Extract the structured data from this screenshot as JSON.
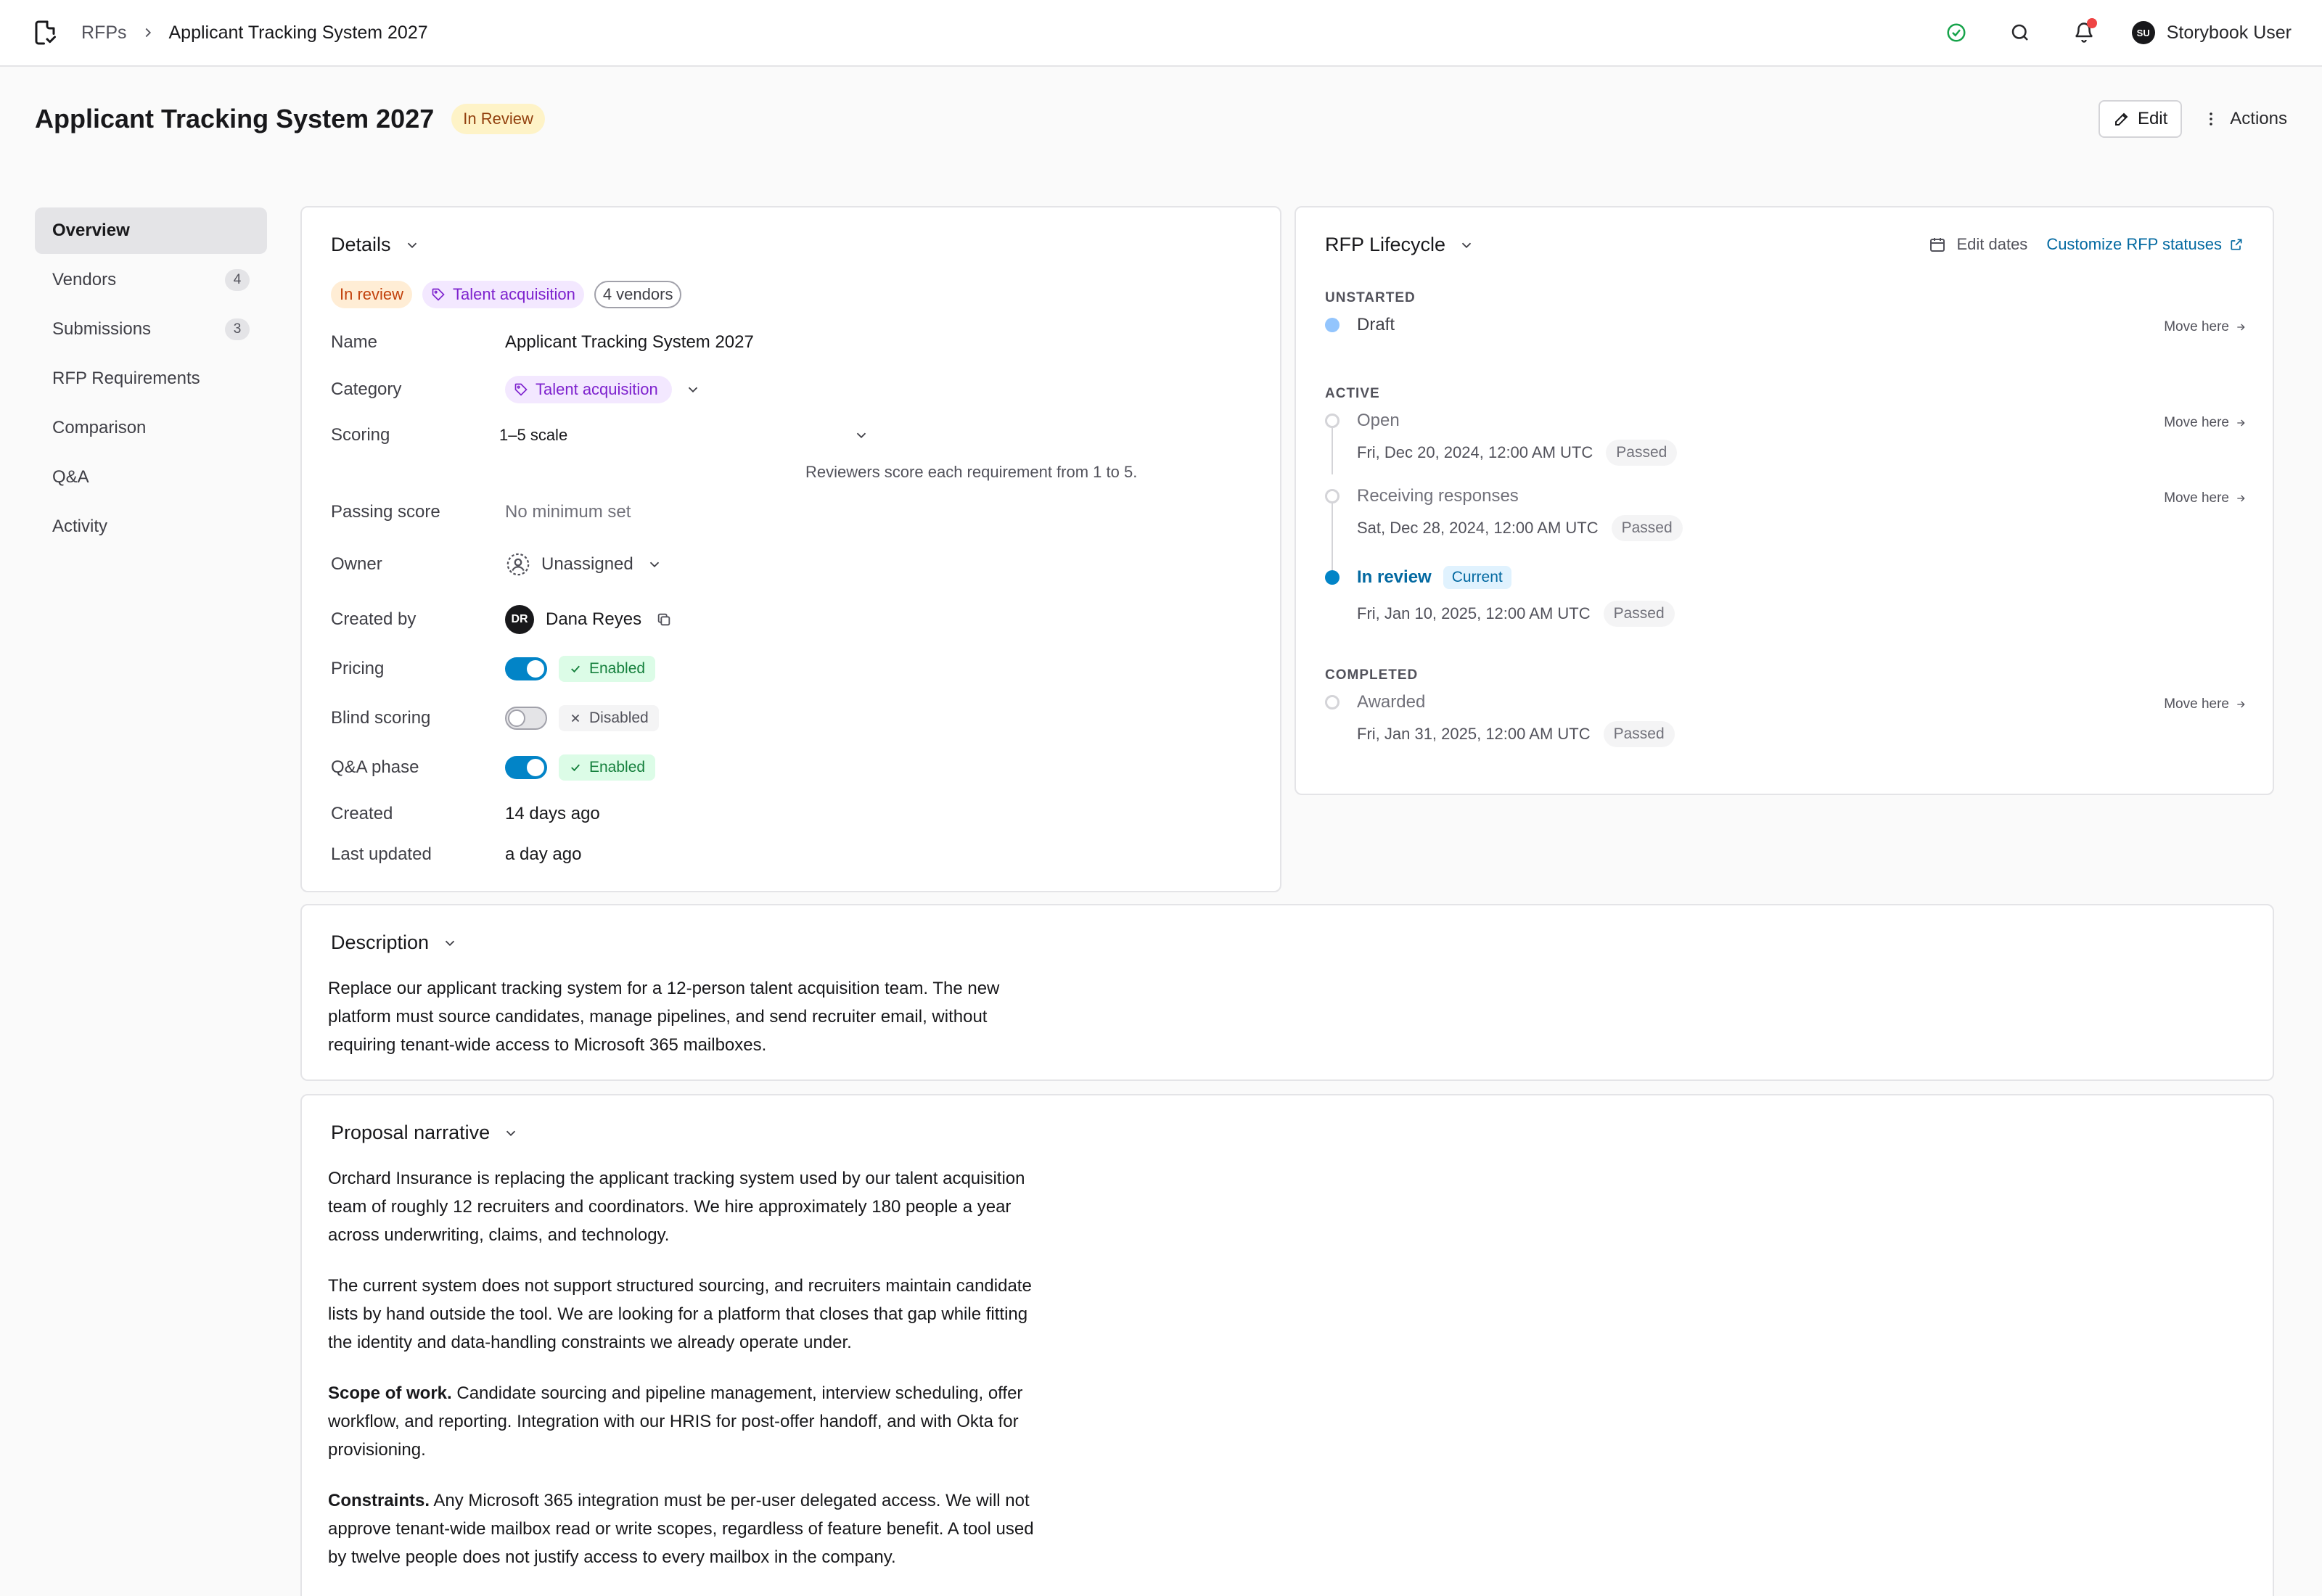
{
  "topbar": {
    "breadcrumb_root": "RFPs",
    "breadcrumb_current": "Applicant Tracking System 2027",
    "user_initials": "SU",
    "user_name": "Storybook User"
  },
  "header": {
    "title": "Applicant Tracking System 2027",
    "status": "In Review",
    "edit_label": "Edit",
    "actions_label": "Actions"
  },
  "sidebar": {
    "items": [
      {
        "label": "Overview",
        "active": true
      },
      {
        "label": "Vendors",
        "count": "4"
      },
      {
        "label": "Submissions",
        "count": "3"
      },
      {
        "label": "RFP Requirements"
      },
      {
        "label": "Comparison"
      },
      {
        "label": "Q&A"
      },
      {
        "label": "Activity"
      }
    ]
  },
  "details": {
    "title": "Details",
    "tags": [
      "In review",
      "Talent acquisition",
      "4 vendors"
    ],
    "name_label": "Name",
    "name_value": "Applicant Tracking System 2027",
    "category_label": "Category",
    "category_value": "Talent acquisition",
    "scoring_label": "Scoring",
    "scoring_value": "1–5 scale",
    "scoring_help": "Reviewers score each requirement from 1 to 5.",
    "passing_label": "Passing score",
    "passing_value": "No minimum set",
    "owner_label": "Owner",
    "owner_value": "Unassigned",
    "created_by_label": "Created by",
    "created_by_initials": "DR",
    "created_by_value": "Dana Reyes",
    "pricing_label": "Pricing",
    "pricing_state": "Enabled",
    "blind_label": "Blind scoring",
    "blind_state": "Disabled",
    "qa_label": "Q&A phase",
    "qa_state": "Enabled",
    "created_label": "Created",
    "created_value": "14 days ago",
    "updated_label": "Last updated",
    "updated_value": "a day ago"
  },
  "lifecycle": {
    "title": "RFP Lifecycle",
    "edit_dates": "Edit dates",
    "customize": "Customize RFP statuses",
    "move_here": "Move here",
    "sections": {
      "unstarted": "UNSTARTED",
      "active": "ACTIVE",
      "completed": "COMPLETED"
    },
    "draft": {
      "name": "Draft"
    },
    "open": {
      "name": "Open",
      "date": "Fri, Dec 20, 2024, 12:00 AM UTC",
      "status": "Passed"
    },
    "receiving": {
      "name": "Receiving responses",
      "date": "Sat, Dec 28, 2024, 12:00 AM UTC",
      "status": "Passed"
    },
    "review": {
      "name": "In review",
      "badge": "Current",
      "date": "Fri, Jan 10, 2025, 12:00 AM UTC",
      "status": "Passed"
    },
    "awarded": {
      "name": "Awarded",
      "date": "Fri, Jan 31, 2025, 12:00 AM UTC",
      "status": "Passed"
    }
  },
  "description": {
    "title": "Description",
    "text": "Replace our applicant tracking system for a 12-person talent acquisition team. The new platform must source candidates, manage pipelines, and send recruiter email, without requiring tenant-wide access to Microsoft 365 mailboxes."
  },
  "narrative": {
    "title": "Proposal narrative",
    "p1": "Orchard Insurance is replacing the applicant tracking system used by our talent acquisition team of roughly 12 recruiters and coordinators. We hire approximately 180 people a year across underwriting, claims, and technology.",
    "p2": "The current system does not support structured sourcing, and recruiters maintain candidate lists by hand outside the tool. We are looking for a platform that closes that gap while fitting the identity and data-handling constraints we already operate under.",
    "p3_lead": "Scope of work.",
    "p3": " Candidate sourcing and pipeline management, interview scheduling, offer workflow, and reporting. Integration with our HRIS for post-offer handoff, and with Okta for provisioning.",
    "p4_lead": "Constraints.",
    "p4": " Any Microsoft 365 integration must be per-user delegated access. We will not approve tenant-wide mailbox read or write scopes, regardless of feature benefit. A tool used by twelve people does not justify access to every mailbox in the company."
  },
  "colors": {
    "accent": "#0284c7",
    "status_review_bg": "#fef3c7",
    "tag_purple": "#7e22ce",
    "enabled_green": "#15803d",
    "notification_red": "#ef4444"
  }
}
